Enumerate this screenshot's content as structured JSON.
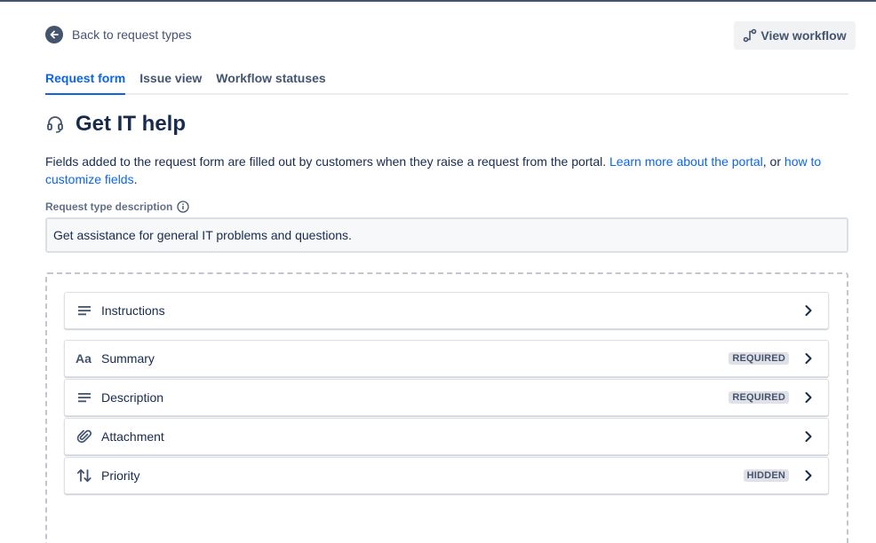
{
  "nav": {
    "back_label": "Back to request types",
    "view_workflow_label": "View workflow"
  },
  "tabs": [
    {
      "label": "Request form",
      "active": true
    },
    {
      "label": "Issue view",
      "active": false
    },
    {
      "label": "Workflow statuses",
      "active": false
    }
  ],
  "page": {
    "title": "Get IT help",
    "title_icon": "headset-icon",
    "intro_text": "Fields added to the request form are filled out by customers when they raise a request from the portal. ",
    "intro_link1": "Learn more about the portal",
    "intro_mid": ", or ",
    "intro_link2": "how to customize fields",
    "intro_end": "."
  },
  "description": {
    "label": "Request type description",
    "value": "Get assistance for general IT problems and questions."
  },
  "fields": [
    {
      "name": "Instructions",
      "icon": "text-lines-icon",
      "badge": ""
    },
    {
      "name": "Summary",
      "icon": "text-style-icon",
      "badge": "REQUIRED"
    },
    {
      "name": "Description",
      "icon": "text-lines-icon",
      "badge": "REQUIRED"
    },
    {
      "name": "Attachment",
      "icon": "paperclip-icon",
      "badge": ""
    },
    {
      "name": "Priority",
      "icon": "sort-arrows-icon",
      "badge": "HIDDEN"
    }
  ],
  "colors": {
    "link": "#0c66e4",
    "text": "#172b4d",
    "subtle": "#44546f",
    "badge_bg": "#dfe1e6"
  }
}
